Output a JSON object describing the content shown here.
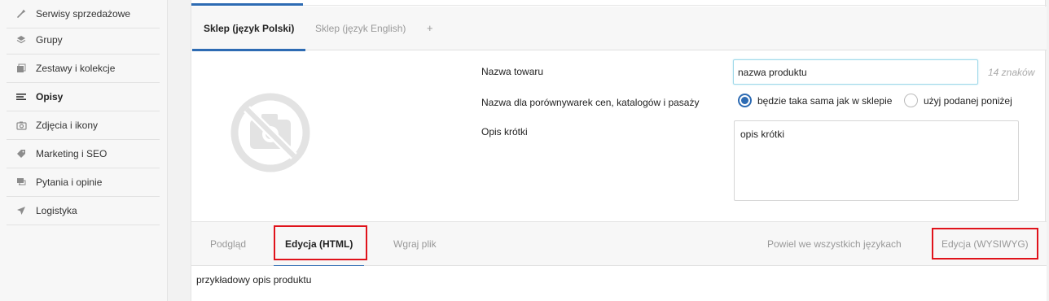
{
  "sidebar": {
    "items": [
      {
        "label": "Serwisy sprzedażowe",
        "icon": "wrench-icon",
        "active": false
      },
      {
        "label": "Grupy",
        "icon": "layers-icon",
        "active": false
      },
      {
        "label": "Zestawy i kolekcje",
        "icon": "collection-icon",
        "active": false
      },
      {
        "label": "Opisy",
        "icon": "align-left-icon",
        "active": true
      },
      {
        "label": "Zdjęcia i ikony",
        "icon": "camera-icon",
        "active": false
      },
      {
        "label": "Marketing i SEO",
        "icon": "tag-icon",
        "active": false
      },
      {
        "label": "Pytania i opinie",
        "icon": "chat-icon",
        "active": false
      },
      {
        "label": "Logistyka",
        "icon": "send-icon",
        "active": false
      }
    ]
  },
  "language_tabs": {
    "tab1": "Sklep (język Polski)",
    "tab2": "Sklep (język English)",
    "add": "+"
  },
  "product": {
    "name_label": "Nazwa towaru",
    "name_value": "nazwa produktu",
    "name_count": "14 znaków",
    "comparison_label": "Nazwa dla porównywarek cen, katalogów i pasaży",
    "radio_same": "będzie taka sama jak w sklepie",
    "radio_custom": "użyj podanej poniżej",
    "short_desc_label": "Opis krótki",
    "short_desc_value": "opis krótki"
  },
  "edit_tabs": {
    "preview": "Podgląd",
    "html": "Edycja (HTML)",
    "upload": "Wgraj plik",
    "repeat": "Powiel we wszystkich językach",
    "wysiwyg": "Edycja (WYSIWYG)"
  },
  "editor": {
    "content": "przykładowy opis produktu"
  },
  "colors": {
    "accent": "#2d6bb3",
    "highlight": "#e0131b"
  }
}
